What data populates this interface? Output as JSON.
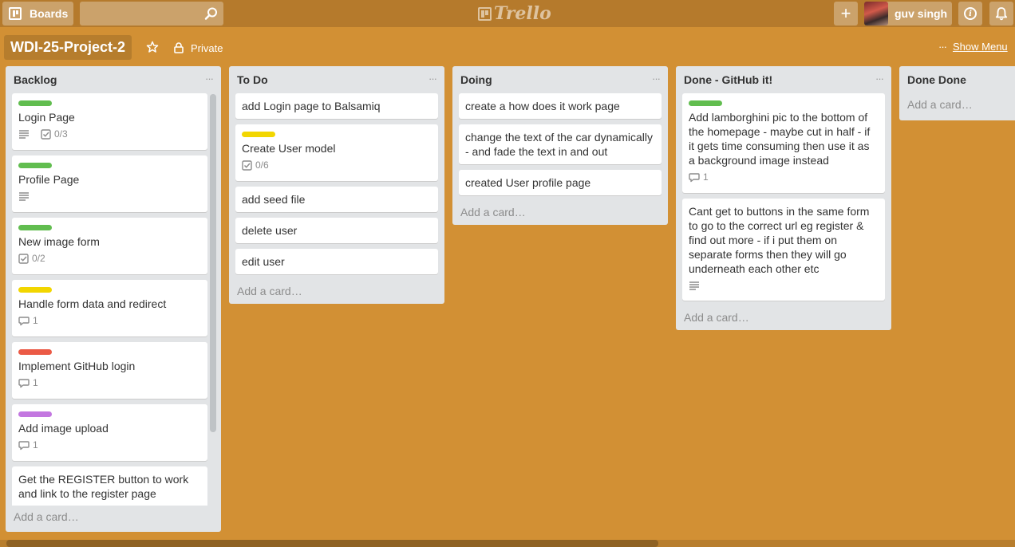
{
  "header": {
    "boards_label": "Boards",
    "search": {
      "value": "",
      "placeholder": ""
    },
    "logo_text": "Trello",
    "user_name": "guv singh"
  },
  "board": {
    "title": "WDI-25-Project-2",
    "visibility": "Private",
    "show_menu_label": "Show Menu",
    "menu_dots": "···"
  },
  "colors": {
    "background": "#d29034",
    "header": "#b57a2c",
    "label_green": "#61bd4f",
    "label_yellow": "#f2d600",
    "label_red": "#eb5a46",
    "label_purple": "#c377e0"
  },
  "lists": [
    {
      "title": "Backlog",
      "add_card": "Add a card…",
      "cards": [
        {
          "title": "Login Page",
          "label": "green",
          "description_icon": true,
          "checklist": "0/3"
        },
        {
          "title": "Profile Page",
          "label": "green",
          "description_icon": true
        },
        {
          "title": "New image form",
          "label": "green",
          "checklist": "0/2"
        },
        {
          "title": "Handle form data and redirect",
          "label": "yellow",
          "comments": "1"
        },
        {
          "title": "Implement GitHub login",
          "label": "red",
          "comments": "1"
        },
        {
          "title": "Add image upload",
          "label": "purple",
          "comments": "1"
        },
        {
          "title": "Get the REGISTER button to work and link to the register page"
        }
      ]
    },
    {
      "title": "To Do",
      "add_card": "Add a card…",
      "cards": [
        {
          "title": "add Login page to Balsamiq"
        },
        {
          "title": "Create User model",
          "label": "yellow",
          "checklist": "0/6"
        },
        {
          "title": "add seed file"
        },
        {
          "title": "delete user"
        },
        {
          "title": "edit user"
        }
      ]
    },
    {
      "title": "Doing",
      "add_card": "Add a card…",
      "cards": [
        {
          "title": "create a how does it work page"
        },
        {
          "title": "change the text of the car dynamically - and fade the text in and out"
        },
        {
          "title": "created User profile page"
        }
      ]
    },
    {
      "title": "Done - GitHub it!",
      "add_card": "Add a card…",
      "cards": [
        {
          "title": "Add lamborghini pic to the bottom of the homepage - maybe cut in half - if it gets time consuming then use it as a background image instead",
          "label": "green",
          "comments": "1"
        },
        {
          "title": "Cant get to buttons in the same form to go to the correct url eg register & find out more - if i put them on separate forms then they will go underneath each other etc",
          "description_icon": true
        }
      ]
    },
    {
      "title": "Done Done",
      "add_card": "Add a card…",
      "cards": []
    }
  ]
}
